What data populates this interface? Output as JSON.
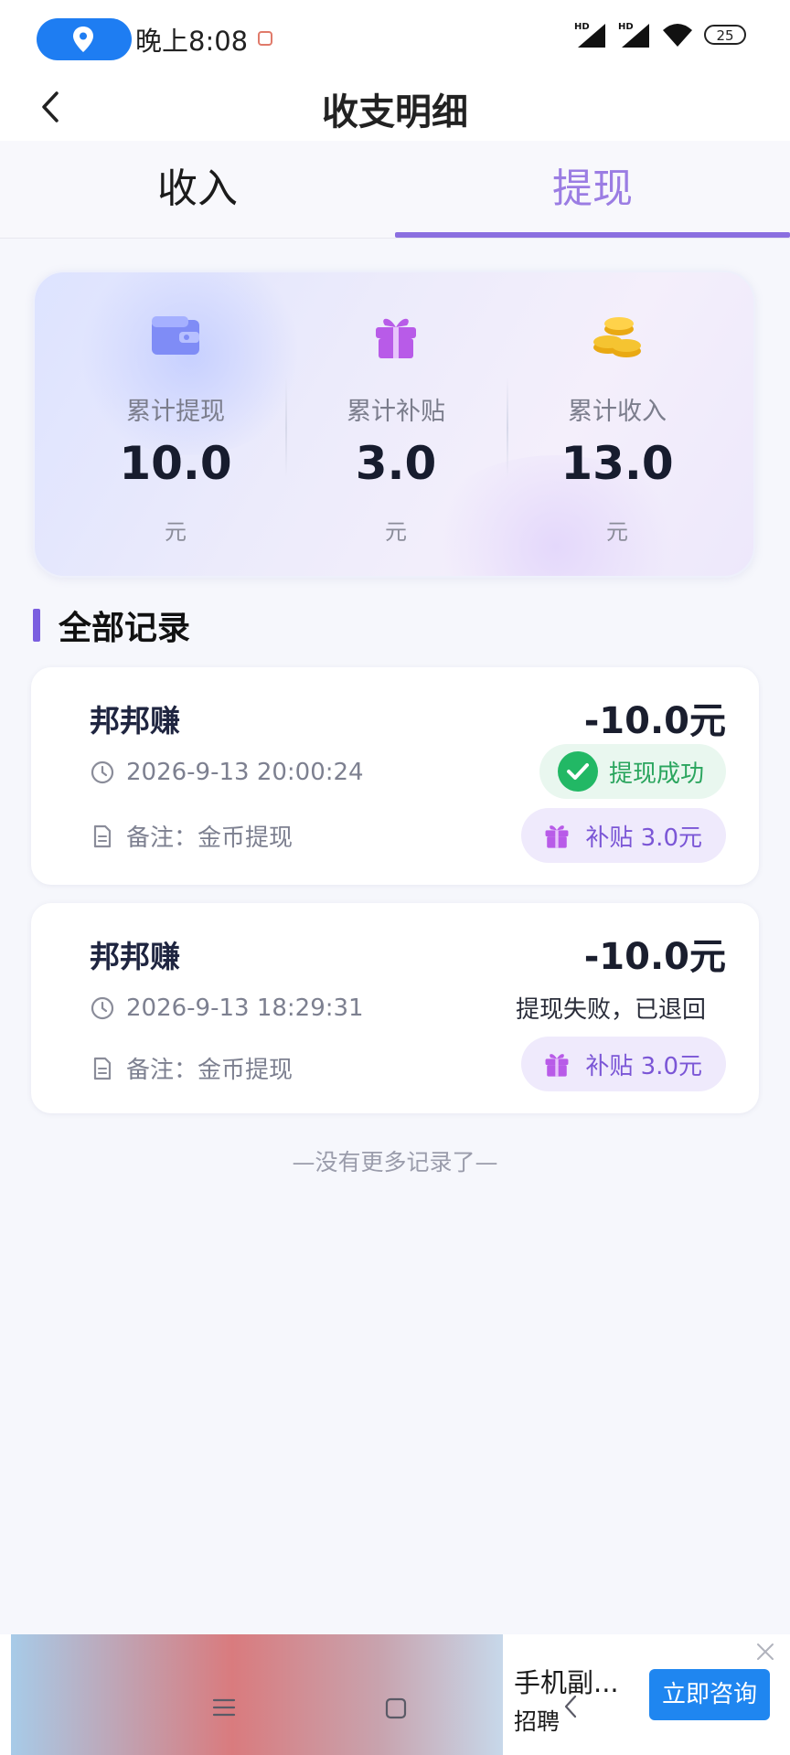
{
  "status_bar": {
    "time": "晚上8:08",
    "battery": "25",
    "network": [
      "HD",
      "HD"
    ]
  },
  "header": {
    "title": "收支明细",
    "back_icon": "chevron-left-icon"
  },
  "tabs": [
    {
      "label": "收入",
      "active": false
    },
    {
      "label": "提现",
      "active": true
    }
  ],
  "summary": {
    "items": [
      {
        "icon": "wallet-icon",
        "label": "累计提现",
        "value": "10.0",
        "unit": "元"
      },
      {
        "icon": "gift-icon",
        "label": "累计补贴",
        "value": "3.0",
        "unit": "元"
      },
      {
        "icon": "coins-icon",
        "label": "累计收入",
        "value": "13.0",
        "unit": "元"
      }
    ]
  },
  "section": {
    "title": "全部记录"
  },
  "records": [
    {
      "name": "邦邦赚",
      "amount": "-10.0元",
      "time": "2026-9-13 20:00:24",
      "note": "备注：金币提现",
      "status": "提现成功",
      "subsidy": "补贴 3.0元"
    },
    {
      "name": "邦邦赚",
      "amount": "-10.0元",
      "time": "2026-9-13 18:29:31",
      "note": "备注：金币提现",
      "status": "提现失败，已退回",
      "subsidy": "补贴 3.0元"
    }
  ],
  "footer": {
    "no_more": "—没有更多记录了—"
  },
  "ad": {
    "title": "手机副...",
    "subtitle": "招聘",
    "button": "立即咨询"
  },
  "colors": {
    "accent": "#8b6fe0",
    "success": "#22b865",
    "subsidy": "#7b56d6",
    "cta": "#1f86f0"
  }
}
